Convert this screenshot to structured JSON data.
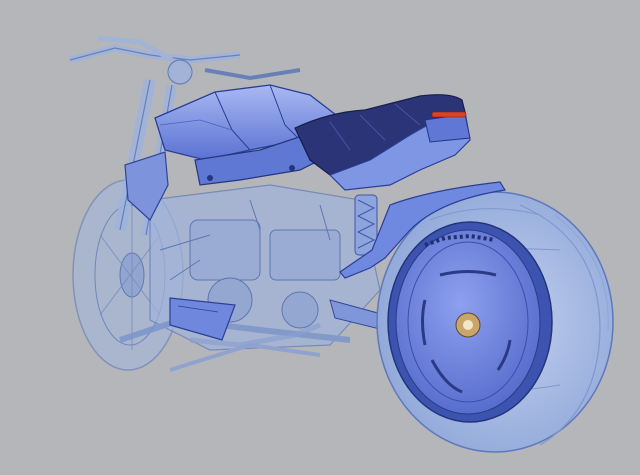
{
  "scene": {
    "subject": "motorcycle-cad-render",
    "colors": {
      "background": "#b4b6b9",
      "ghost": "#9fb5de",
      "ghost_line": "#5a78b8",
      "solid": "#6d86e0",
      "solid_light": "#98a9ef",
      "solid_dark": "#3a4fa8",
      "edge": "#2a3a80",
      "seat": "#2c3478",
      "seat_light": "#4a55a6",
      "tire": "#a9bde4",
      "tire_dark": "#7f98cf",
      "taillight": "#d8432c"
    }
  }
}
